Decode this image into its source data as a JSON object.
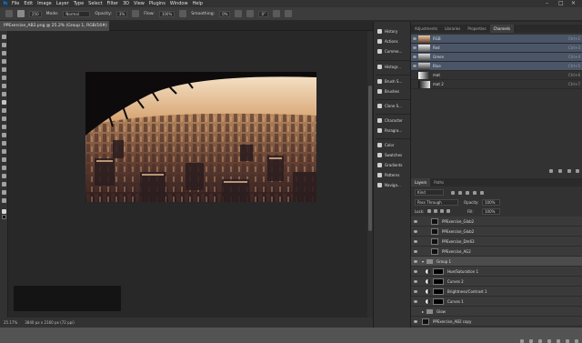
{
  "menubar": {
    "logo": "Ps",
    "items": [
      "File",
      "Edit",
      "Image",
      "Layer",
      "Type",
      "Select",
      "Filter",
      "3D",
      "View",
      "Plugins",
      "Window",
      "Help"
    ]
  },
  "options": {
    "mode_label": "Mode:",
    "mode_value": "Normal",
    "opacity_label": "Opacity:",
    "opacity_value": "3%",
    "flow_label": "Flow:",
    "flow_value": "100%",
    "smoothing_label": "Smoothing:",
    "smoothing_value": "0%",
    "brush_size": "250",
    "angle_value": "0°"
  },
  "document": {
    "tab_title": "PPExercise_AB2.png @ 25.2% (Group 1, RGB/16#) *"
  },
  "statusbar": {
    "zoom": "25.17%",
    "dimensions": "3840 px x 2160 px (72 ppi)"
  },
  "iconpanel": {
    "items": [
      "History",
      "Actions",
      "Comme...",
      "Histogr...",
      "Brush S...",
      "Brushes",
      "Clone S...",
      "Character",
      "Paragra...",
      "Color",
      "Swatches",
      "Gradients",
      "Patterns",
      "Naviga..."
    ]
  },
  "channels_panel": {
    "tabs": [
      "Adjustments",
      "Libraries",
      "Properties",
      "Channels"
    ],
    "active_tab": "Channels",
    "rows": [
      {
        "name": "RGB",
        "shortcut": "Ctrl+2"
      },
      {
        "name": "Red",
        "shortcut": "Ctrl+3"
      },
      {
        "name": "Green",
        "shortcut": "Ctrl+4"
      },
      {
        "name": "Blue",
        "shortcut": "Ctrl+5"
      },
      {
        "name": "mat",
        "shortcut": "Ctrl+6"
      },
      {
        "name": "mat 2",
        "shortcut": "Ctrl+7"
      }
    ]
  },
  "layers_panel": {
    "tabs": [
      "Layers",
      "Paths"
    ],
    "active_tab": "Layers",
    "filter_kind": "Kind",
    "blend_mode": "Pass Through",
    "opacity_label": "Opacity:",
    "opacity_value": "100%",
    "lock_label": "Lock:",
    "fill_label": "Fill:",
    "fill_value": "100%",
    "layers": [
      {
        "name": "PPExercise_Glob2"
      },
      {
        "name": "PPExercise_Glob2"
      },
      {
        "name": "PPExercise_Dm63"
      },
      {
        "name": "PPExercise_AG2"
      },
      {
        "name": "Group 1"
      },
      {
        "name": "Hue/Saturation 1"
      },
      {
        "name": "Curves 2"
      },
      {
        "name": "Brightness/Contrast 1"
      },
      {
        "name": "Curves 1"
      },
      {
        "name": "Glow"
      },
      {
        "name": "PPExercise_AB2 copy"
      }
    ]
  },
  "colors": {
    "selection": "#4a5568",
    "accent": "#31a8ff"
  }
}
